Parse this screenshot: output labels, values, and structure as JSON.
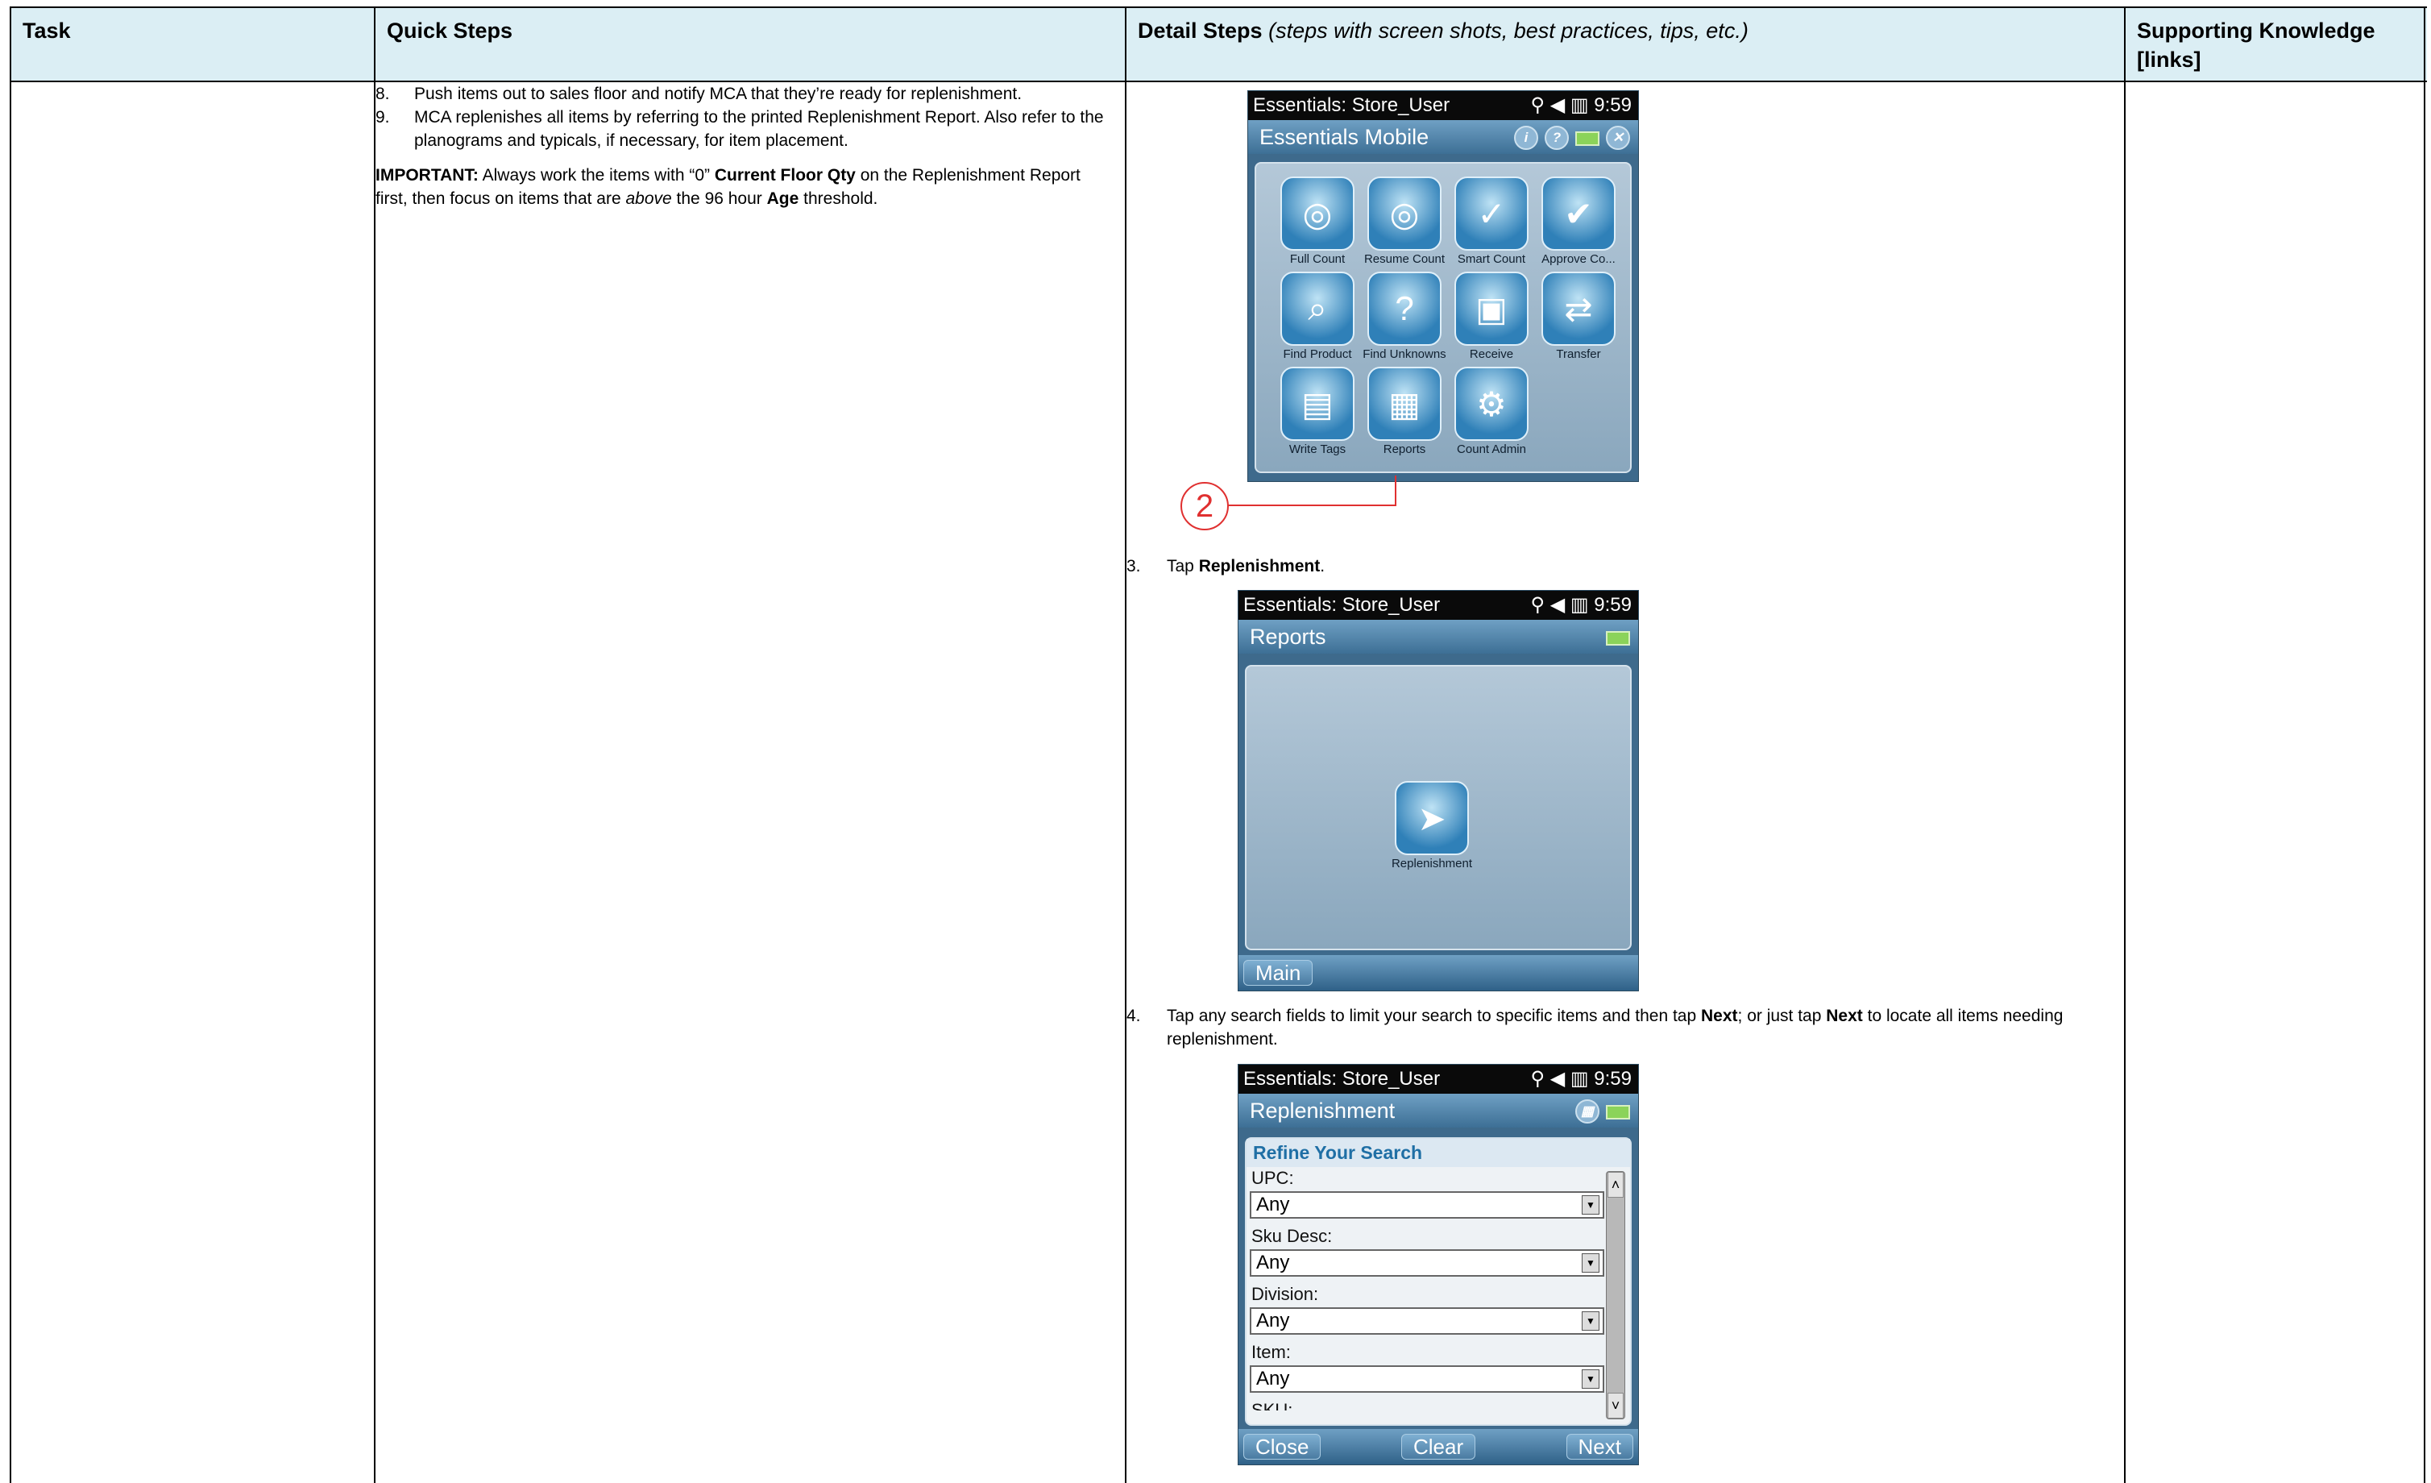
{
  "header": {
    "task": "Task",
    "quick_steps": "Quick Steps",
    "detail_steps": "Detail Steps",
    "detail_steps_note": "(steps with screen shots, best practices, tips, etc.)",
    "supporting_knowledge": "Supporting Knowledge [links]"
  },
  "quick_steps": {
    "items": [
      {
        "num": "8.",
        "text": "Push items out to sales floor and notify MCA that they’re ready for replenishment."
      },
      {
        "num": "9.",
        "text": "MCA replenishes all items by referring to the printed Replenishment Report. Also refer to the planograms and typicals, if necessary, for item placement."
      }
    ],
    "important_label": "IMPORTANT:",
    "important_p1": " Always work the items with “0” ",
    "important_b1": "Current Floor Qty",
    "important_p2": " on the Replenishment Report first, then focus on items that are ",
    "important_i1": "above",
    "important_p3": " the 96 hour ",
    "important_b2": "Age",
    "important_p4": " threshold."
  },
  "detail": {
    "callout_number": "2",
    "step3": {
      "num": "3.",
      "pre": "Tap ",
      "bold": "Replenishment",
      "post": "."
    },
    "step4": {
      "num": "4.",
      "p1": "Tap any search fields to limit your search to specific items and then tap ",
      "b1": "Next",
      "p2": "; or just tap ",
      "b2": "Next",
      "p3": " to locate all items needing replenishment."
    }
  },
  "device": {
    "status_title": "Essentials: Store_User",
    "time": "9:59",
    "screen1": {
      "title": "Essentials Mobile",
      "apps": [
        "Full Count",
        "Resume Count",
        "Smart Count",
        "Approve Co...",
        "Find Product",
        "Find Unknowns",
        "Receive",
        "Transfer",
        "Write Tags",
        "Reports",
        "Count Admin"
      ]
    },
    "screen2": {
      "title": "Reports",
      "app": "Replenishment",
      "back_button": "Main"
    },
    "screen3": {
      "title": "Replenishment",
      "section": "Refine Your Search",
      "fields": [
        {
          "label": "UPC:",
          "value": "Any"
        },
        {
          "label": "Sku Desc:",
          "value": "Any"
        },
        {
          "label": "Division:",
          "value": "Any"
        },
        {
          "label": "Item:",
          "value": "Any"
        }
      ],
      "partial_label": "SKU:",
      "close_button": "Close",
      "clear_button": "Clear",
      "next_button": "Next"
    }
  }
}
